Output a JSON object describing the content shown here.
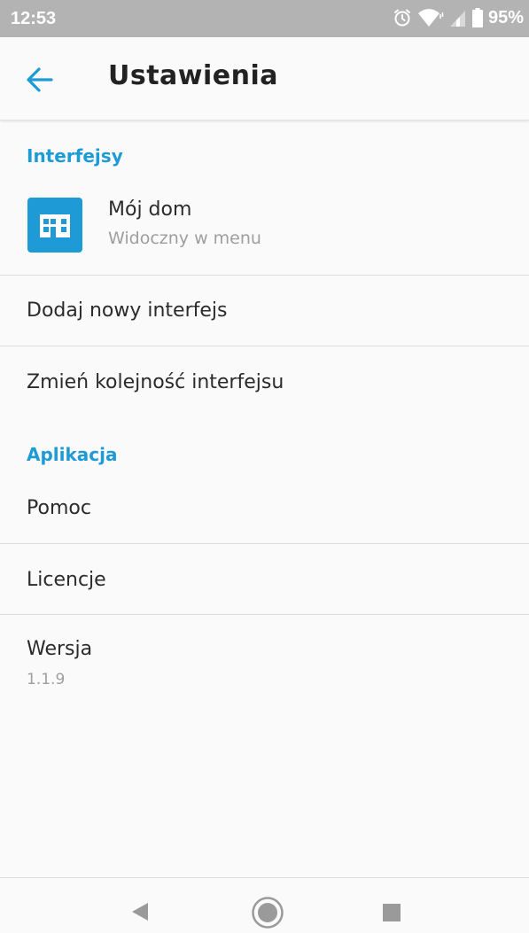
{
  "status_bar": {
    "time": "12:53",
    "battery": "95%",
    "icons": [
      "alarm-icon",
      "wifi-icon",
      "signal-icon",
      "battery-icon"
    ]
  },
  "app_bar": {
    "back_icon": "arrow-left-icon",
    "title": "Ustawienia"
  },
  "sections": {
    "interfaces": {
      "header": "Interfejsy",
      "home": {
        "icon": "house-icon",
        "title": "Mój dom",
        "subtitle": "Widoczny w menu"
      },
      "add_label": "Dodaj nowy interfejs",
      "reorder_label": "Zmień kolejność interfejsu"
    },
    "application": {
      "header": "Aplikacja",
      "help_label": "Pomoc",
      "licenses_label": "Licencje",
      "version_label": "Wersja",
      "version_value": "1.1.9"
    }
  },
  "colors": {
    "accent": "#1e9bd6",
    "status_bar": "#b3b3b3",
    "background": "#fafafa",
    "divider": "#dcdcdc"
  },
  "nav_bar": {
    "icons": [
      "back-triangle-icon",
      "home-circle-icon",
      "recents-square-icon"
    ]
  }
}
